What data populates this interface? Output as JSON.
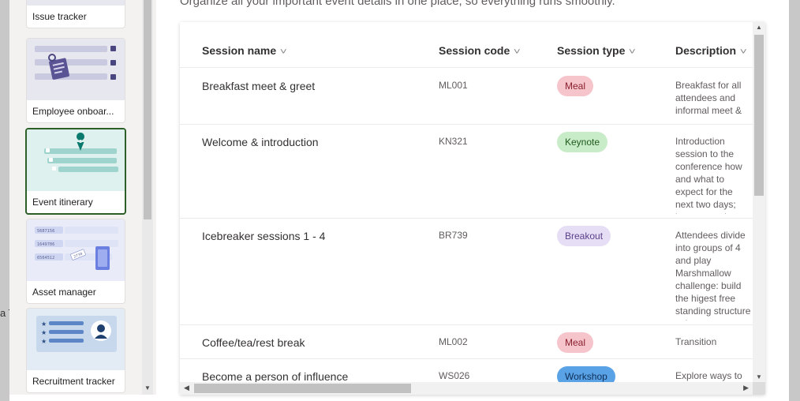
{
  "backdrop": {
    "fragment": "a T"
  },
  "templates": [
    {
      "label": "Issue tracker",
      "selected": false
    },
    {
      "label": "Employee onboar...",
      "selected": false
    },
    {
      "label": "Event itinerary",
      "selected": true
    },
    {
      "label": "Asset manager",
      "selected": false
    },
    {
      "label": "Recruitment tracker",
      "selected": false
    }
  ],
  "asset_thumb": {
    "codes": [
      "5687156",
      "1649786",
      "6564512"
    ],
    "tag": "2738"
  },
  "subtitle": "Organize all your important event details in one place, so everything runs smoothly.",
  "table": {
    "columns": [
      "Session name",
      "Session code",
      "Session type",
      "Description"
    ],
    "rows": [
      {
        "name": "Breakfast meet & greet",
        "code": "ML001",
        "type": "Meal",
        "description": "Breakfast for all attendees and informal meet & greet"
      },
      {
        "name": "Welcome & introduction",
        "code": "KN321",
        "type": "Keynote",
        "description": "Introduction session to the conference how and what to expect for the next two days; how to get the most of the conference"
      },
      {
        "name": "Icebreaker sessions 1 - 4",
        "code": "BR739",
        "type": "Breakout",
        "description": "Attendees divide into groups of 4 and play Marshmallow challenge: build the higest free standing structure using tape, sphagetti and marshmallow. Go!"
      },
      {
        "name": "Coffee/tea/rest break",
        "code": "ML002",
        "type": "Meal",
        "description": "Transition"
      },
      {
        "name": "Become a person of influence",
        "code": "WS026",
        "type": "Workshop",
        "description": "Explore ways to"
      }
    ]
  },
  "type_colors": {
    "Meal": {
      "bg": "#f6c5cc",
      "fg": "#8a1f2d"
    },
    "Keynote": {
      "bg": "#c9ecc8",
      "fg": "#1f5a1d"
    },
    "Breakout": {
      "bg": "#e6def5",
      "fg": "#5a3f8a"
    },
    "Workshop": {
      "bg": "#5aa2e6",
      "fg": "#0e2f57"
    }
  }
}
